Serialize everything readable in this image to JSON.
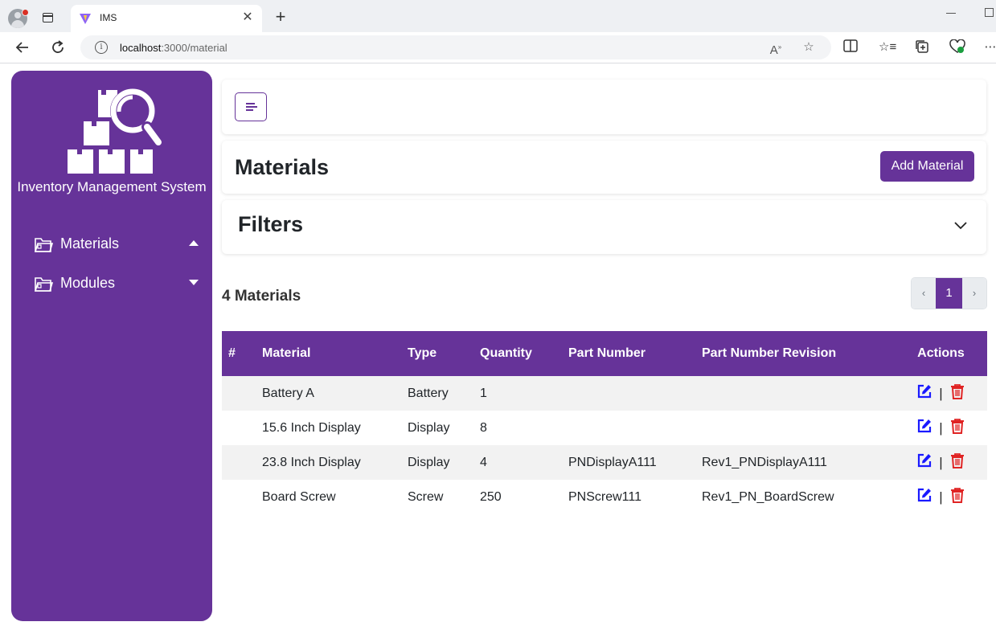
{
  "browser": {
    "tab_title": "IMS",
    "tab_close": "✕",
    "new_tab": "+",
    "url_host": "localhost",
    "url_path": ":3000/material",
    "icons": [
      "profile-icon",
      "tab-actions-icon",
      "back-icon",
      "refresh-icon",
      "site-info-icon",
      "read-aloud-icon",
      "favorite-star-icon",
      "split-screen-icon",
      "favorites-icon",
      "collections-icon",
      "browser-essentials-icon",
      "more-icon"
    ]
  },
  "sidebar": {
    "app_name": "Inventory Management System",
    "items": [
      {
        "label": "Materials",
        "expanded": true
      },
      {
        "label": "Modules",
        "expanded": false
      }
    ],
    "color": "#663399"
  },
  "header": {
    "title": "Materials",
    "add_button": "Add Material"
  },
  "filters": {
    "title": "Filters"
  },
  "summary": {
    "count_label": "4 Materials"
  },
  "pagination": {
    "prev": "‹",
    "current": "1",
    "next": "›"
  },
  "table": {
    "columns": [
      "#",
      "Material",
      "Type",
      "Quantity",
      "Part Number",
      "Part Number Revision",
      "Actions"
    ],
    "rows": [
      {
        "index": "",
        "material": "Battery A",
        "type": "Battery",
        "quantity": "1",
        "part_number": "",
        "revision": ""
      },
      {
        "index": "",
        "material": "15.6 Inch Display",
        "type": "Display",
        "quantity": "8",
        "part_number": "",
        "revision": ""
      },
      {
        "index": "",
        "material": "23.8 Inch Display",
        "type": "Display",
        "quantity": "4",
        "part_number": "PNDisplayA111",
        "revision": "Rev1_PNDisplayA111"
      },
      {
        "index": "",
        "material": "Board Screw",
        "type": "Screw",
        "quantity": "250",
        "part_number": "PNScrew111",
        "revision": "Rev1_PN_BoardScrew"
      }
    ],
    "action_separator": "|"
  },
  "colors": {
    "accent": "#663399",
    "edit": "#1a1aff",
    "delete": "#e02424"
  }
}
